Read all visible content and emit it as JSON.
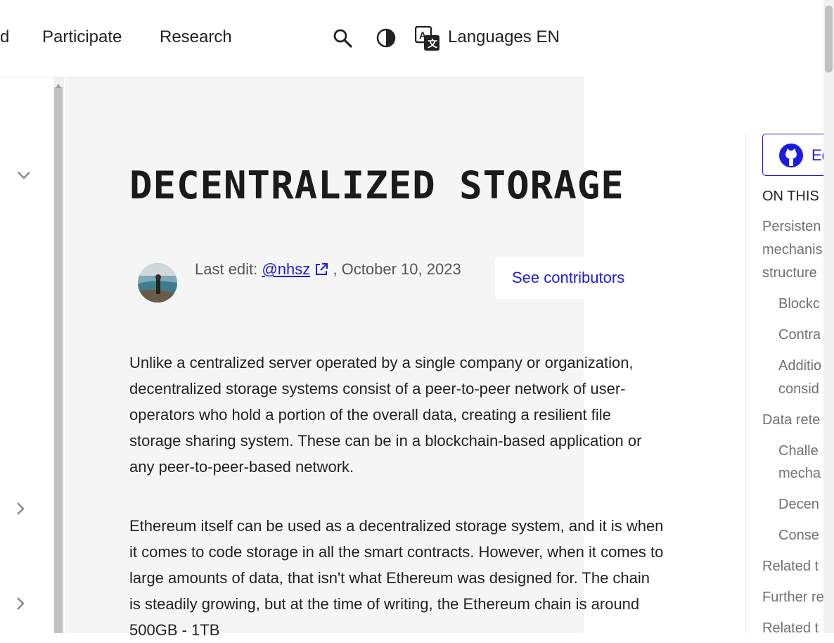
{
  "nav": {
    "partial_item": "d",
    "participate": "Participate",
    "research": "Research",
    "languages": "Languages EN"
  },
  "article": {
    "title": "DECENTRALIZED STORAGE",
    "last_edit_prefix": "Last edit: ",
    "author": "@nhsz",
    "date": ", October 10, 2023",
    "see_contributors": "See contributors",
    "para1": "Unlike a centralized server operated by a single company or organization, decentralized storage systems consist of a peer-to-peer network of user-operators who hold a portion of the overall data, creating a resilient file storage sharing system. These can be in a blockchain-based application or any peer-to-peer-based network.",
    "para2": "Ethereum itself can be used as a decentralized storage system, and it is when it comes to code storage in all the smart contracts. However, when it comes to large amounts of data, that isn't what Ethereum was designed for. The chain is steadily growing, but at the time of writing, the Ethereum chain is around 500GB - 1TB"
  },
  "toc": {
    "edit_label": "Ed",
    "heading": "ON THIS",
    "items": [
      "Persisten",
      "mechanis",
      "structure",
      "Blockc",
      "Contra",
      "Additio",
      "consid",
      "Data rete",
      "Challe",
      "mecha",
      "Decen",
      "Conse",
      "Related t",
      "Further re",
      "Related t"
    ]
  },
  "colors": {
    "link": "#1c1ce1",
    "content_bg": "#f5f5f5"
  }
}
